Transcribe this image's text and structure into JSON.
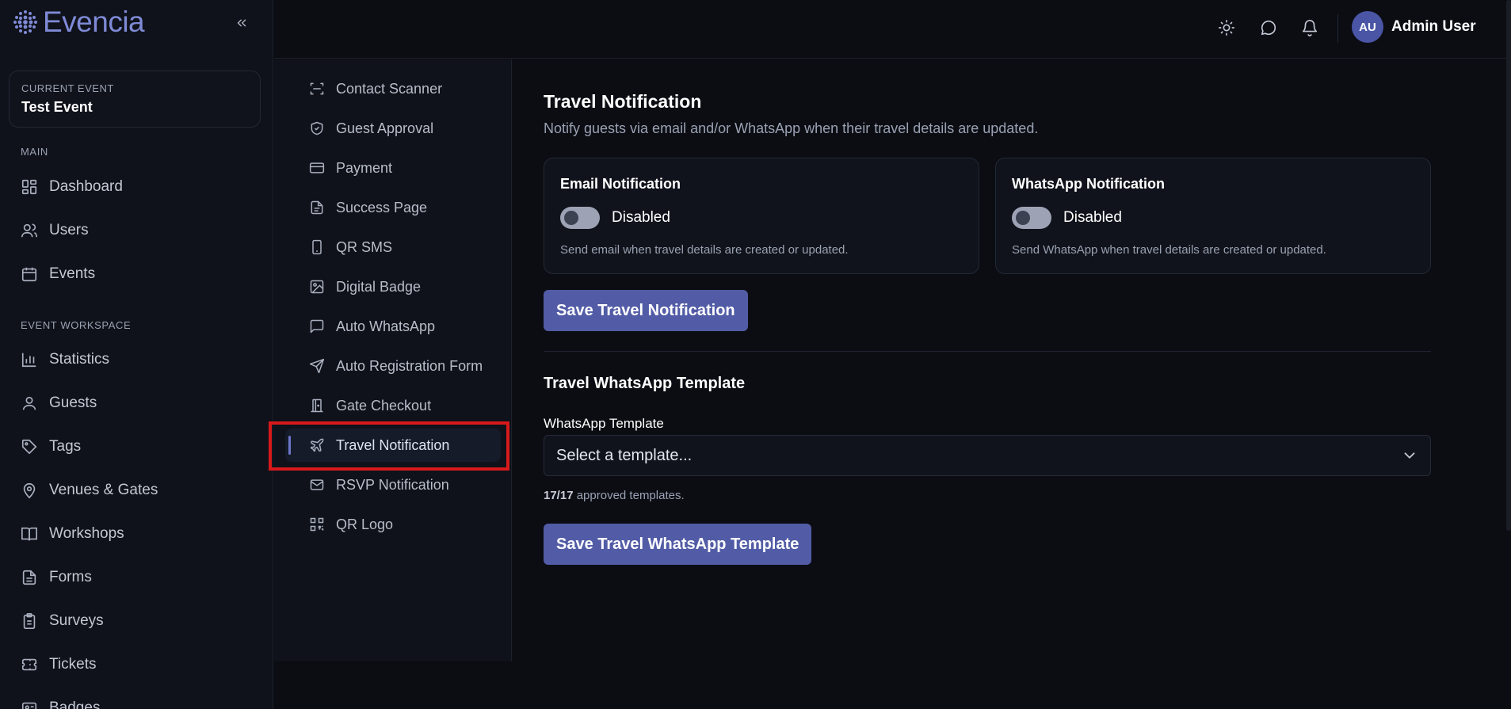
{
  "brand": {
    "name": "Evencia"
  },
  "current_event": {
    "caption": "CURRENT EVENT",
    "name": "Test Event"
  },
  "sidebar": {
    "main_label": "MAIN",
    "main_items": [
      {
        "label": "Dashboard",
        "icon": "dashboard-icon"
      },
      {
        "label": "Users",
        "icon": "users-icon"
      },
      {
        "label": "Events",
        "icon": "calendar-icon"
      }
    ],
    "workspace_label": "EVENT WORKSPACE",
    "workspace_items": [
      {
        "label": "Statistics",
        "icon": "bar-chart-icon"
      },
      {
        "label": "Guests",
        "icon": "user-icon"
      },
      {
        "label": "Tags",
        "icon": "tag-icon"
      },
      {
        "label": "Venues & Gates",
        "icon": "map-pin-icon"
      },
      {
        "label": "Workshops",
        "icon": "book-open-icon"
      },
      {
        "label": "Forms",
        "icon": "file-text-icon"
      },
      {
        "label": "Surveys",
        "icon": "clipboard-icon"
      },
      {
        "label": "Tickets",
        "icon": "ticket-icon"
      },
      {
        "label": "Badges",
        "icon": "badge-icon"
      }
    ]
  },
  "topbar": {
    "user_initials": "AU",
    "user_name": "Admin User"
  },
  "submenu": {
    "items": [
      {
        "label": "Contact Scanner",
        "icon": "scan-icon"
      },
      {
        "label": "Guest Approval",
        "icon": "shield-check-icon"
      },
      {
        "label": "Payment",
        "icon": "credit-card-icon"
      },
      {
        "label": "Success Page",
        "icon": "document-icon"
      },
      {
        "label": "QR SMS",
        "icon": "phone-icon"
      },
      {
        "label": "Digital Badge",
        "icon": "image-icon"
      },
      {
        "label": "Auto WhatsApp",
        "icon": "message-square-icon"
      },
      {
        "label": "Auto Registration Form",
        "icon": "send-icon"
      },
      {
        "label": "Gate Checkout",
        "icon": "door-icon"
      },
      {
        "label": "Travel Notification",
        "icon": "plane-icon",
        "active": true
      },
      {
        "label": "RSVP Notification",
        "icon": "mail-icon"
      },
      {
        "label": "QR Logo",
        "icon": "qr-code-icon"
      }
    ]
  },
  "main": {
    "title": "Travel Notification",
    "subtitle": "Notify guests via email and/or WhatsApp when their travel details are updated.",
    "email_card": {
      "title": "Email Notification",
      "status": "Disabled",
      "description": "Send email when travel details are created or updated."
    },
    "whatsapp_card": {
      "title": "WhatsApp Notification",
      "status": "Disabled",
      "description": "Send WhatsApp when travel details are created or updated."
    },
    "save_notification_label": "Save Travel Notification",
    "template_section_title": "Travel WhatsApp Template",
    "template_field_label": "WhatsApp Template",
    "template_select_value": "Select a template...",
    "template_count": "17/17",
    "template_count_suffix": " approved templates.",
    "save_template_label": "Save Travel WhatsApp Template"
  },
  "colors": {
    "accent": "#525ca6",
    "brand": "#7f8ad6",
    "highlight": "#d8191c"
  }
}
